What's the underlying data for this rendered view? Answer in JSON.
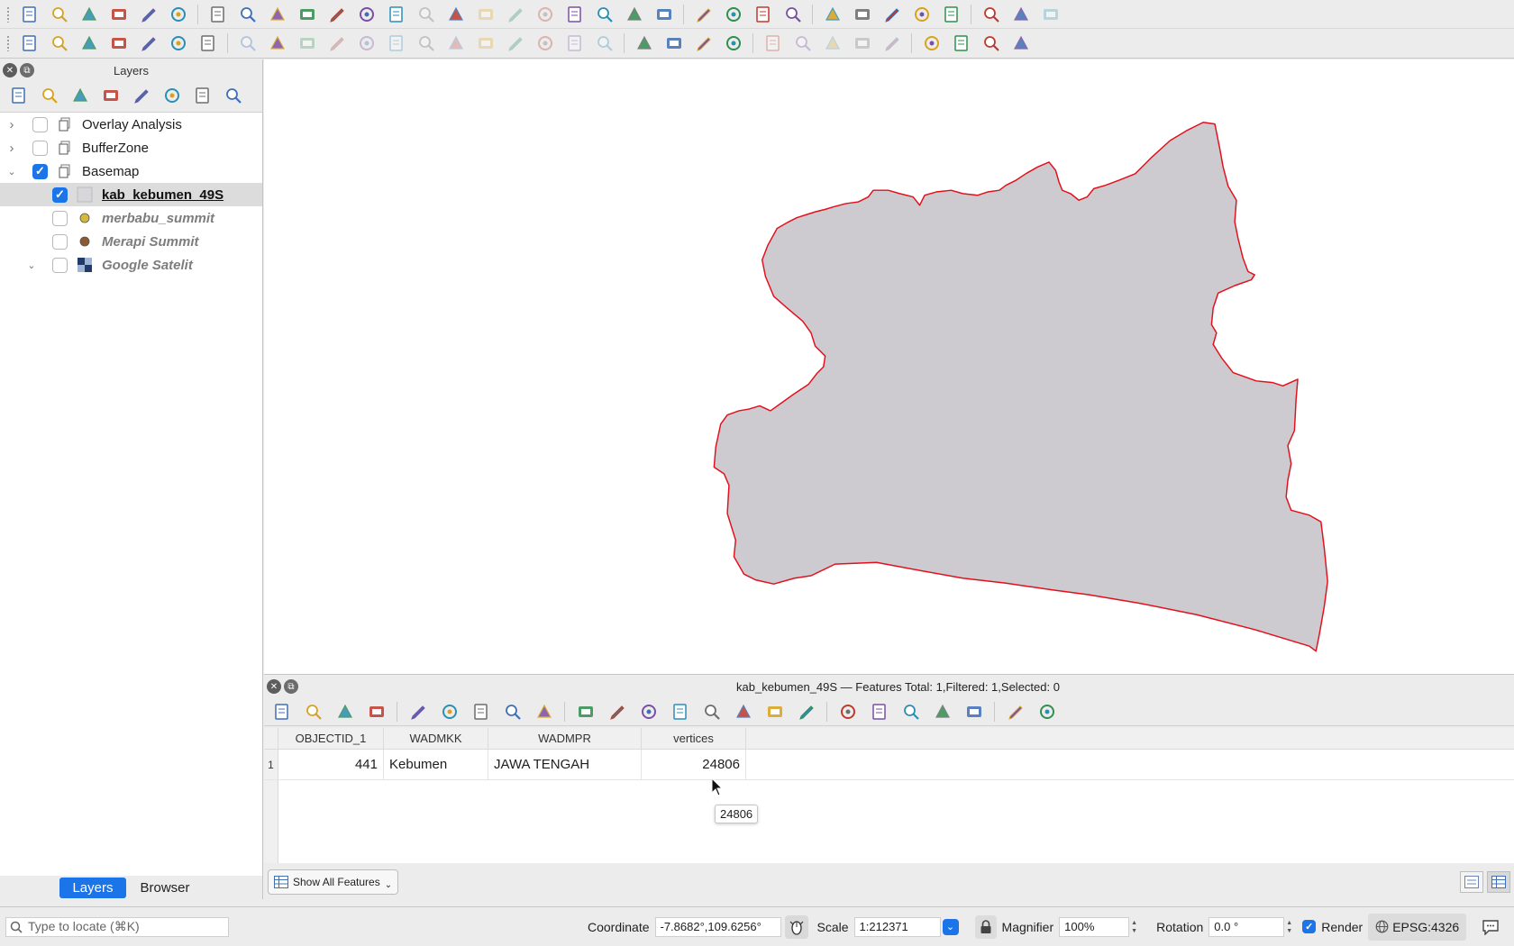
{
  "toolbar_row1": [
    {
      "icon": "new-project-icon",
      "enabled": true
    },
    {
      "icon": "open-project-icon",
      "enabled": true
    },
    {
      "icon": "save-project-icon",
      "enabled": true
    },
    {
      "icon": "new-print-layout-icon",
      "enabled": true
    },
    {
      "icon": "layout-manager-icon",
      "enabled": true
    },
    {
      "icon": "style-manager-icon",
      "enabled": true
    },
    {
      "icon": "pan-icon",
      "enabled": true
    },
    {
      "icon": "pan-to-selection-icon",
      "enabled": true
    },
    {
      "icon": "zoom-in-icon",
      "enabled": true
    },
    {
      "icon": "zoom-out-icon",
      "enabled": true
    },
    {
      "icon": "zoom-full-icon",
      "enabled": true
    },
    {
      "icon": "zoom-to-selection-icon",
      "enabled": true
    },
    {
      "icon": "zoom-to-layer-icon",
      "enabled": true
    },
    {
      "icon": "zoom-native-icon",
      "enabled": false
    },
    {
      "icon": "zoom-last-icon",
      "enabled": true
    },
    {
      "icon": "zoom-next-icon",
      "enabled": false
    },
    {
      "icon": "new-map-view-icon",
      "enabled": false
    },
    {
      "icon": "new-3d-view-icon",
      "enabled": false
    },
    {
      "icon": "bookmark-icon",
      "enabled": true
    },
    {
      "icon": "show-bookmarks-icon",
      "enabled": true
    },
    {
      "icon": "temporal-controller-icon",
      "enabled": true
    },
    {
      "icon": "refresh-icon",
      "enabled": true
    },
    {
      "icon": "select-features-icon",
      "enabled": true
    },
    {
      "icon": "select-by-expression-icon",
      "enabled": true
    },
    {
      "icon": "deselect-icon",
      "enabled": true
    },
    {
      "icon": "select-by-location-icon",
      "enabled": true
    },
    {
      "icon": "identify-icon",
      "enabled": true
    },
    {
      "icon": "attribute-table-icon",
      "enabled": true
    },
    {
      "icon": "processing-toolbox-icon",
      "enabled": true
    },
    {
      "icon": "statistics-icon",
      "enabled": true
    },
    {
      "icon": "open-field-calculator-icon",
      "enabled": true
    },
    {
      "icon": "measure-icon",
      "enabled": true
    },
    {
      "icon": "map-tips-icon",
      "enabled": true
    },
    {
      "icon": "locator-filter-icon",
      "enabled": false
    }
  ],
  "toolbar_row2": [
    {
      "icon": "data-source-manager-icon",
      "enabled": true
    },
    {
      "icon": "new-geopackage-layer-icon",
      "enabled": true
    },
    {
      "icon": "add-vector-layer-icon",
      "enabled": true
    },
    {
      "icon": "add-delimited-text-icon",
      "enabled": true
    },
    {
      "icon": "add-raster-layer-icon",
      "enabled": true
    },
    {
      "icon": "add-mesh-layer-icon",
      "enabled": true
    },
    {
      "icon": "add-virtual-layer-icon",
      "enabled": true
    },
    {
      "icon": "current-edits-icon",
      "enabled": false
    },
    {
      "icon": "toggle-editing-icon",
      "enabled": true
    },
    {
      "icon": "save-edits-icon",
      "enabled": false
    },
    {
      "icon": "digitize-icon",
      "enabled": false
    },
    {
      "icon": "add-feature-icon",
      "enabled": false
    },
    {
      "icon": "vertex-tool-icon",
      "enabled": false
    },
    {
      "icon": "modify-attributes-icon",
      "enabled": false
    },
    {
      "icon": "delete-selected-icon",
      "enabled": false
    },
    {
      "icon": "cut-features-icon",
      "enabled": false
    },
    {
      "icon": "copy-features-icon",
      "enabled": false
    },
    {
      "icon": "paste-features-icon",
      "enabled": false
    },
    {
      "icon": "undo-icon",
      "enabled": false
    },
    {
      "icon": "redo-icon",
      "enabled": false
    },
    {
      "icon": "label-tool-icon",
      "enabled": true
    },
    {
      "icon": "diagram-options-icon",
      "enabled": true
    },
    {
      "icon": "highlight-pinned-labels-icon",
      "enabled": true
    },
    {
      "icon": "pin-labels-icon",
      "enabled": true
    },
    {
      "icon": "show-hide-labels-icon",
      "enabled": false
    },
    {
      "icon": "move-label-icon",
      "enabled": false
    },
    {
      "icon": "rotate-label-icon",
      "enabled": false
    },
    {
      "icon": "change-label-icon",
      "enabled": false
    },
    {
      "icon": "label-properties-icon",
      "enabled": false
    },
    {
      "icon": "metasearch-icon",
      "enabled": true
    },
    {
      "icon": "python-console-icon",
      "enabled": true
    },
    {
      "icon": "georeferencer-icon",
      "enabled": true
    },
    {
      "icon": "help-contents-icon",
      "enabled": true
    }
  ],
  "layers_panel": {
    "title": "Layers",
    "tools": [
      "style-icon",
      "add-group-icon",
      "manage-visibility-icon",
      "filter-legend-icon",
      "filter-expression-icon",
      "expand-all-icon",
      "collapse-all-icon",
      "remove-layer-icon"
    ],
    "tree": [
      {
        "label": "Overlay Analysis",
        "type": "group",
        "checked": false,
        "expanded": false,
        "indent": 0,
        "style": "normal"
      },
      {
        "label": "BufferZone",
        "type": "group",
        "checked": false,
        "expanded": false,
        "indent": 0,
        "style": "normal"
      },
      {
        "label": "Basemap",
        "type": "group",
        "checked": true,
        "expanded": true,
        "indent": 0,
        "style": "normal"
      },
      {
        "label": "kab_kebumen_49S",
        "type": "polygon",
        "checked": true,
        "indent": 1,
        "style": "active",
        "symbol_color": "#d7d6da"
      },
      {
        "label": "merbabu_summit",
        "type": "point",
        "checked": false,
        "indent": 1,
        "style": "hidden",
        "symbol_color": "#d6b83a"
      },
      {
        "label": "Merapi Summit",
        "type": "point",
        "checked": false,
        "indent": 1,
        "style": "hidden",
        "symbol_color": "#8a5a32"
      },
      {
        "label": "Google Satelit",
        "type": "raster",
        "checked": false,
        "expanded": true,
        "indent": 1,
        "style": "hidden"
      }
    ],
    "tabs": [
      "Layers",
      "Browser"
    ],
    "active_tab": "Layers"
  },
  "map": {
    "fill_color": "#cdcbd0",
    "stroke_color": "#e3101c"
  },
  "attribute_table": {
    "title": "kab_kebumen_49S — Features Total: 1,Filtered: 1,Selected: 0",
    "tools": [
      "toggle-editing-icon",
      "multi-edit-icon",
      "save-edits-icon",
      "reload-icon",
      "add-feature-icon",
      "delete-feature-icon",
      "cut-icon",
      "copy-icon",
      "paste-icon",
      "select-by-expression-icon",
      "select-all-icon",
      "invert-selection-icon",
      "deselect-all-icon",
      "filter-selection-icon",
      "move-selection-to-top-icon",
      "pan-to-selected-icon",
      "zoom-to-selected-icon",
      "new-field-icon",
      "delete-field-icon",
      "field-calculator-icon",
      "conditional-formatting-icon",
      "actions-icon",
      "dock-table-icon",
      "form-view-icon"
    ],
    "columns": [
      "OBJECTID_1",
      "WADMKK",
      "WADMPR",
      "vertices"
    ],
    "rows": [
      {
        "num": "1",
        "OBJECTID_1": "441",
        "WADMKK": "Kebumen",
        "WADMPR": "JAWA TENGAH",
        "vertices": "24806"
      }
    ],
    "tooltip": "24806",
    "show_features_label": "Show All Features"
  },
  "status_bar": {
    "locator_placeholder": "Type to locate (⌘K)",
    "coordinate_label": "Coordinate",
    "coordinate_value": "-7.8682°,109.6256°",
    "scale_label": "Scale",
    "scale_value": "1:212371",
    "magnifier_label": "Magnifier",
    "magnifier_value": "100%",
    "rotation_label": "Rotation",
    "rotation_value": "0.0 °",
    "render_label": "Render",
    "render_checked": true,
    "crs": "EPSG:4326"
  }
}
